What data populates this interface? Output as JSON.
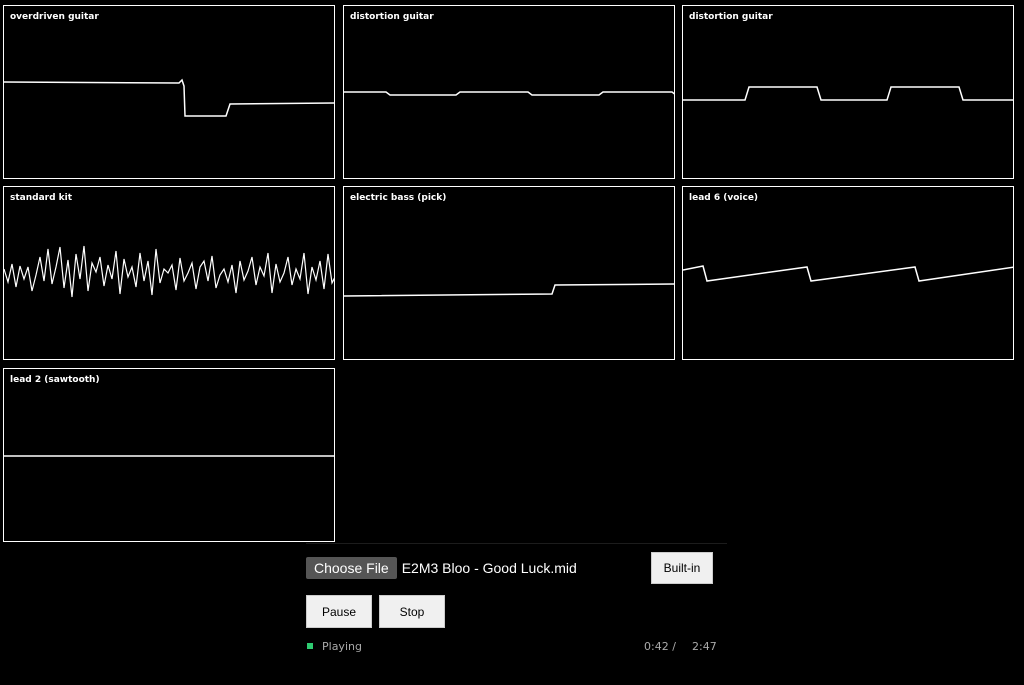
{
  "panels": [
    {
      "label": "overdriven guitar"
    },
    {
      "label": "distortion guitar"
    },
    {
      "label": "distortion guitar"
    },
    {
      "label": "standard kit"
    },
    {
      "label": "electric bass (pick)"
    },
    {
      "label": "lead 6 (voice)"
    },
    {
      "label": "lead 2 (sawtooth)"
    }
  ],
  "file": {
    "choose_label": "Choose File",
    "file_name": "E2M3 Bloo - Good Luck.mid"
  },
  "buttons": {
    "builtin_label": "Built-in",
    "pause_label": "Pause",
    "stop_label": "Stop"
  },
  "status": {
    "state": "Playing",
    "current_time": "0:42 /",
    "total_time": "2:47",
    "indicator_color": "#2ecc71"
  }
}
